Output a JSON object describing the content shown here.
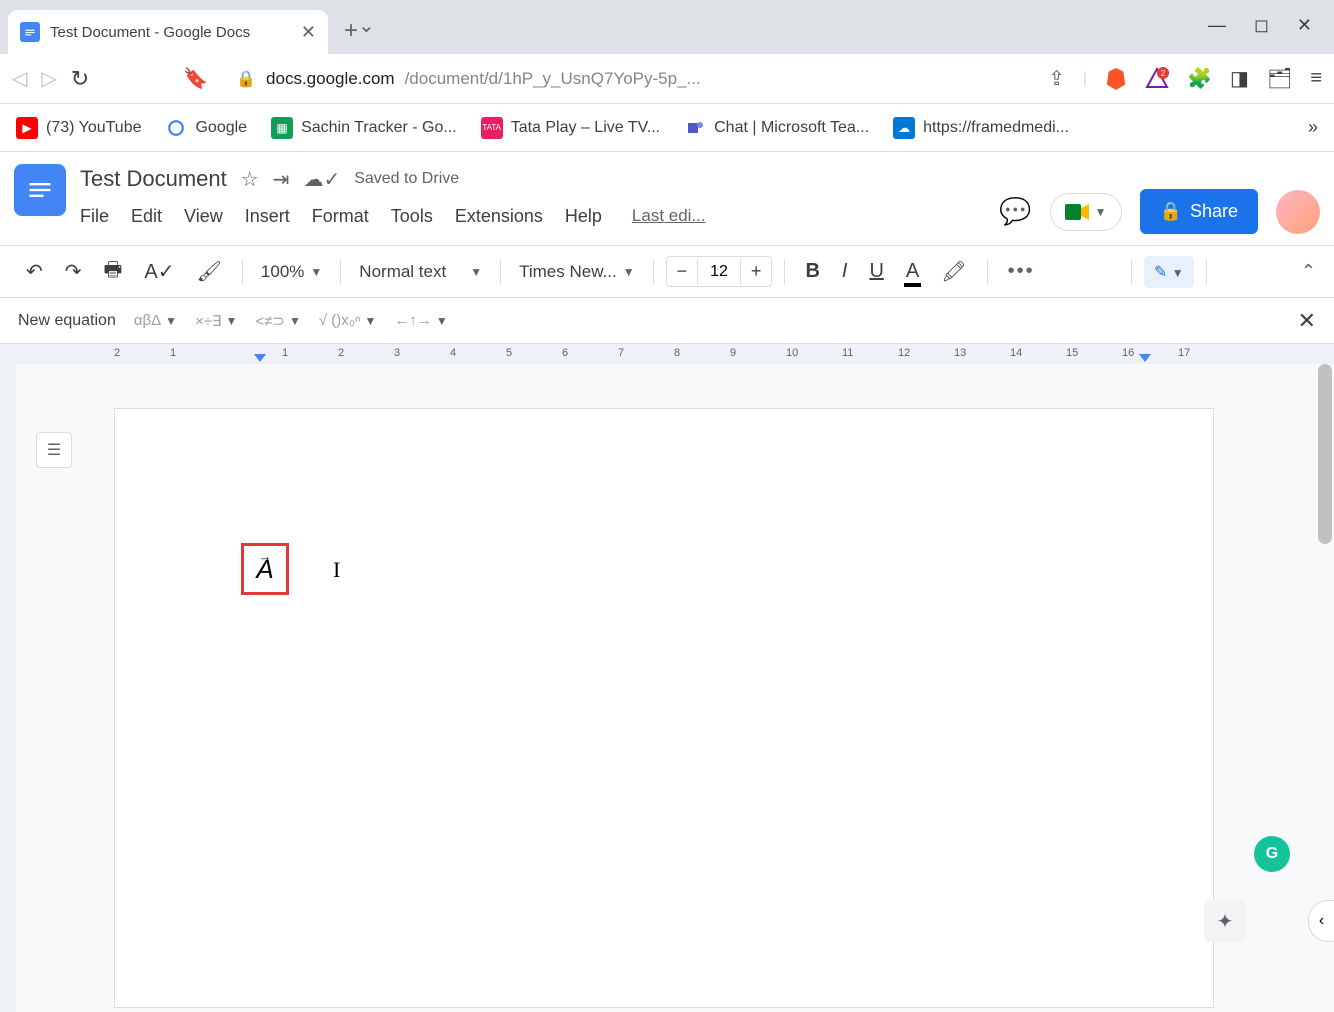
{
  "browser": {
    "tab_title": "Test Document - Google Docs",
    "url_host": "docs.google.com",
    "url_path": "/document/d/1hP_y_UsnQ7YoPy-5p_...",
    "brave_badge": "2"
  },
  "bookmarks": {
    "youtube": "(73) YouTube",
    "google": "Google",
    "sheets": "Sachin Tracker - Go...",
    "tata": "Tata Play – Live TV...",
    "teams": "Chat | Microsoft Tea...",
    "framed": "https://framedmedi..."
  },
  "docs": {
    "title": "Test Document",
    "saved": "Saved to Drive",
    "menus": {
      "file": "File",
      "edit": "Edit",
      "view": "View",
      "insert": "Insert",
      "format": "Format",
      "tools": "Tools",
      "extensions": "Extensions",
      "help": "Help"
    },
    "last_edit": "Last edi...",
    "share": "Share"
  },
  "toolbar": {
    "zoom": "100%",
    "style": "Normal text",
    "font": "Times New...",
    "size": "12"
  },
  "equation": {
    "label": "New equation",
    "greek": "αβΔ",
    "ops": "×÷∃",
    "rel": "<≠⊃",
    "math": "√ ()x₀ⁿ",
    "arrows": "←↑→"
  },
  "ruler": [
    "2",
    "1",
    "",
    "1",
    "2",
    "3",
    "4",
    "5",
    "6",
    "7",
    "8",
    "9",
    "10",
    "11",
    "12",
    "13",
    "14",
    "15",
    "16",
    "17"
  ],
  "content": {
    "equation_letter": "A",
    "equation_arrow": "→"
  }
}
